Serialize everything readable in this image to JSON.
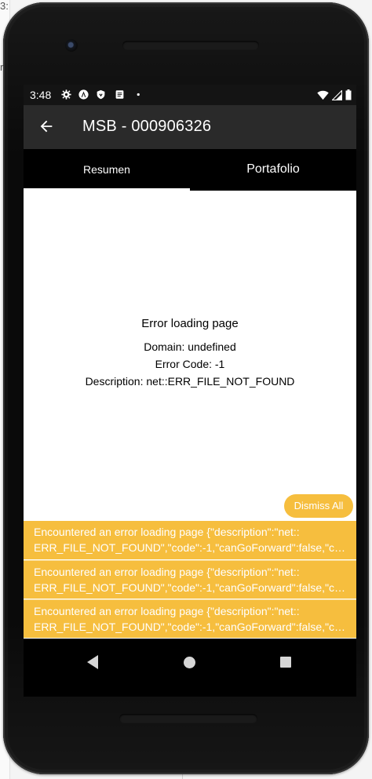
{
  "background": {
    "fragment_top": "3:",
    "fragment_mid": "r"
  },
  "statusbar": {
    "time": "3:48"
  },
  "appbar": {
    "title": "MSB - 000906326",
    "back_icon": "arrow-left-icon"
  },
  "tabs": [
    {
      "label": "Resumen",
      "selected": true
    },
    {
      "label": "Portafolio",
      "selected": false
    }
  ],
  "error": {
    "heading": "Error loading page",
    "domain": "Domain: undefined",
    "code": "Error Code: -1",
    "description": "Description: net::ERR_FILE_NOT_FOUND"
  },
  "dismiss_label": "Dismiss All",
  "toasts": [
    {
      "line1": "Encountered an error loading page {\"description\":\"net::",
      "line2": "ERR_FILE_NOT_FOUND\",\"code\":-1,\"canGoForward\":false,\"can..."
    },
    {
      "line1": "Encountered an error loading page {\"description\":\"net::",
      "line2": "ERR_FILE_NOT_FOUND\",\"code\":-1,\"canGoForward\":false,\"can..."
    },
    {
      "line1": "Encountered an error loading page {\"description\":\"net::",
      "line2": "ERR_FILE_NOT_FOUND\",\"code\":-1,\"canGoForward\":false,\"can..."
    }
  ],
  "colors": {
    "warning": "#f6be3e",
    "appbar": "#2a2a2a",
    "tabs": "#000000"
  }
}
